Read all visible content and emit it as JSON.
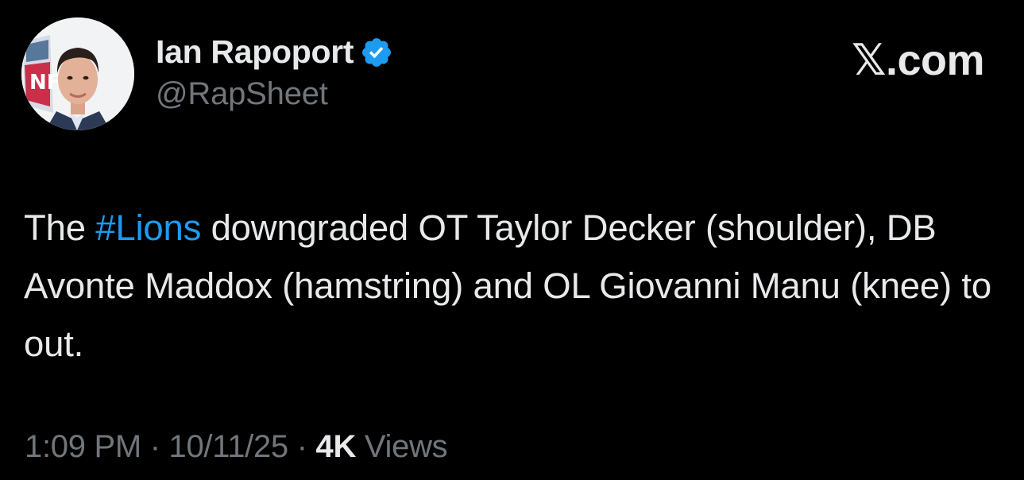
{
  "author": {
    "name": "Ian Rapoport",
    "handle": "@RapSheet",
    "verified": true,
    "avatar_icon": "profile-photo-with-nfl-shield"
  },
  "brand": {
    "x_glyph": "𝕏",
    "domain": ".com"
  },
  "tweet": {
    "segments": [
      {
        "text": "The ",
        "type": "text"
      },
      {
        "text": "#Lions",
        "type": "hashtag"
      },
      {
        "text": " downgraded OT Taylor Decker (shoulder), DB Avonte Maddox (hamstring) and OL Giovanni Manu (knee) to out.",
        "type": "text"
      }
    ]
  },
  "meta": {
    "time": "1:09 PM",
    "sep": " · ",
    "date": "10/11/25",
    "views_count": "4K",
    "views_label": " Views"
  },
  "colors": {
    "background": "#000000",
    "text": "#e7e9ea",
    "secondary": "#71767b",
    "link": "#1d9bf0"
  }
}
